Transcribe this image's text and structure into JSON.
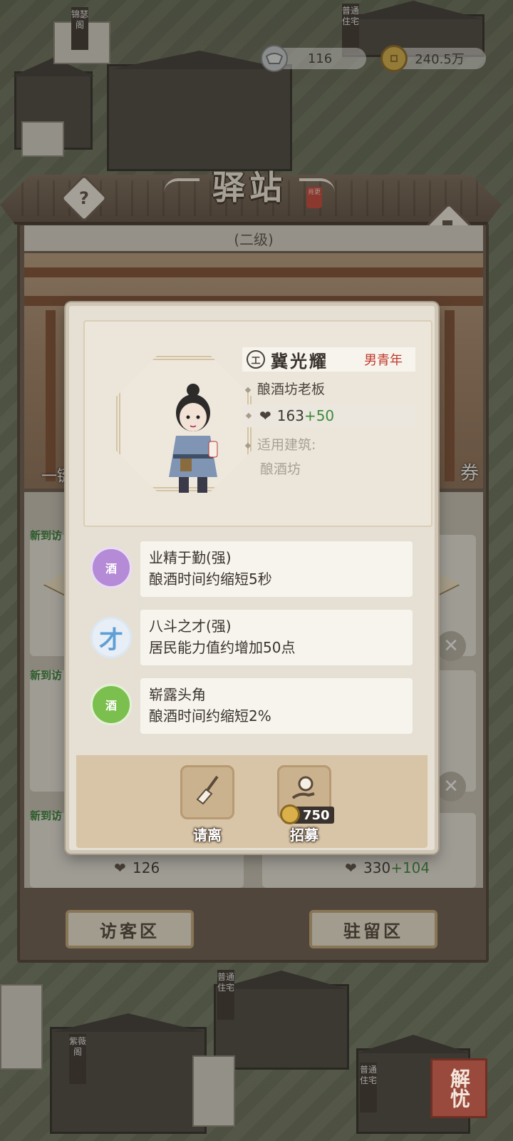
{
  "resources": {
    "silver": {
      "icon": "silver-ingot-icon",
      "value": "116"
    },
    "coins": {
      "icon": "copper-coin-icon",
      "value": "240.5万"
    }
  },
  "station": {
    "title": "驿站",
    "seal_text": "肖更",
    "level": "(二级)",
    "help_icon": "question-icon",
    "build_icon": "hammer-icon"
  },
  "background": {
    "new_tags": [
      "新到访",
      "新到访",
      "新到访"
    ],
    "left_label_partial": "一键",
    "right_label_partial": "券",
    "visitor_values": [
      {
        "base": "126",
        "plus": ""
      },
      {
        "base": "330",
        "plus": "+104"
      }
    ]
  },
  "modal": {
    "rank": "工",
    "name": "冀光耀",
    "gender_age": "男青年",
    "occupation": "酿酒坊老板",
    "ability_base": "163",
    "ability_plus": "+50",
    "building_label": "适用建筑:",
    "building": "酿酒坊",
    "skills": [
      {
        "icon_text": "酒",
        "name": "业精于勤(强)",
        "desc": "酿酒时间约缩短5秒",
        "color": "#b58ad6"
      },
      {
        "icon_text": "才",
        "name": "八斗之才(强)",
        "desc": "居民能力值约增加50点",
        "color": "#5d9fd6"
      },
      {
        "icon_text": "酒",
        "name": "崭露头角",
        "desc": "酿酒时间约缩短2%",
        "color": "#7bbf4e"
      }
    ],
    "actions": {
      "dismiss": {
        "label": "请离",
        "icon": "broom-icon"
      },
      "recruit": {
        "label": "招募",
        "icon": "recruit-hand-icon",
        "cost": "750"
      }
    }
  },
  "tabs": {
    "visitor": "访客区",
    "stay": "驻留区"
  },
  "corner_label": "解忧",
  "town_signs": [
    "锦瑟阁",
    "普通住宅",
    "紫薇阁",
    "普通住宅",
    "普通住宅"
  ]
}
